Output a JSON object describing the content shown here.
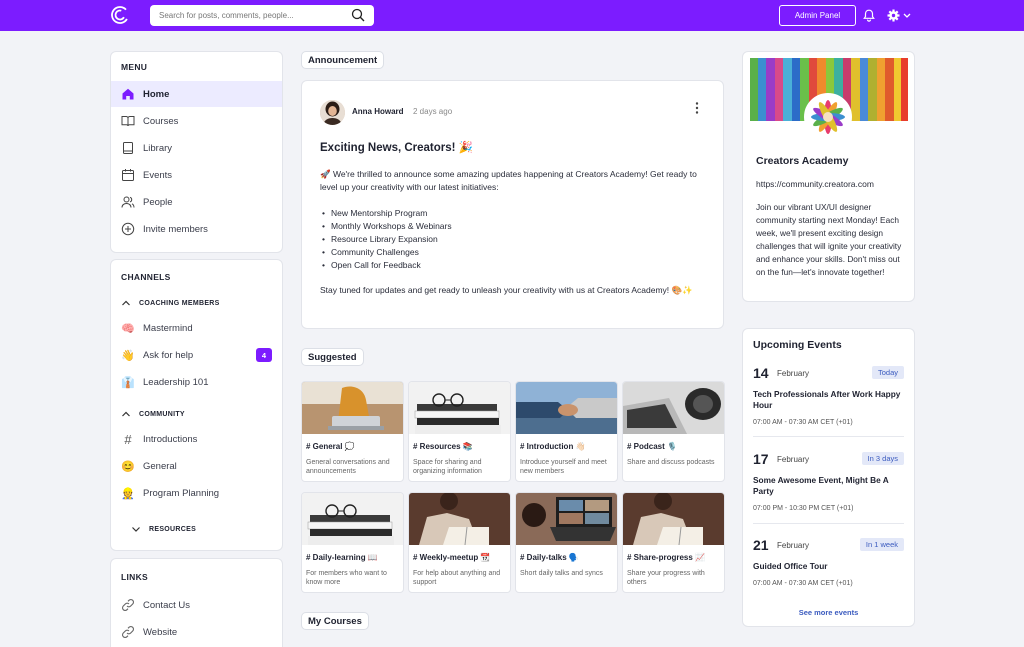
{
  "topbar": {
    "search_placeholder": "Search for posts, comments, people...",
    "admin_label": "Admin Panel"
  },
  "menu": {
    "title": "MENU",
    "items": [
      {
        "label": "Home",
        "icon": "home-icon",
        "active": true
      },
      {
        "label": "Courses",
        "icon": "book-open-icon"
      },
      {
        "label": "Library",
        "icon": "library-icon"
      },
      {
        "label": "Events",
        "icon": "calendar-icon"
      },
      {
        "label": "People",
        "icon": "people-icon"
      },
      {
        "label": "Invite members",
        "icon": "plus-circle-icon"
      }
    ]
  },
  "channels": {
    "title": "CHANNELS",
    "groups": [
      {
        "label": "COACHING MEMBERS",
        "items": [
          {
            "label": "Mastermind",
            "icon": "🧠"
          },
          {
            "label": "Ask for help",
            "icon": "👋",
            "badge": "4"
          },
          {
            "label": "Leadership 101",
            "icon": "👔"
          }
        ]
      },
      {
        "label": "COMMUNITY",
        "items": [
          {
            "label": "Introductions",
            "icon": "#"
          },
          {
            "label": "General",
            "icon": "😊"
          },
          {
            "label": "Program Planning",
            "icon": "👷"
          }
        ]
      },
      {
        "label": "RESOURCES",
        "items": []
      }
    ]
  },
  "links": {
    "title": "LINKS",
    "items": [
      {
        "label": "Contact Us"
      },
      {
        "label": "Website"
      }
    ]
  },
  "announcement": {
    "section_label": "Announcement",
    "author": "Anna Howard",
    "time": "2 days ago",
    "title": "Exciting News, Creators! 🎉",
    "intro": "🚀 We're thrilled to announce some amazing updates happening at Creators Academy! Get ready to level up your creativity with our latest initiatives:",
    "bullets": [
      "New Mentorship Program",
      "Monthly Workshops & Webinars",
      "Resource Library Expansion",
      "Community Challenges",
      "Open Call for Feedback"
    ],
    "outro": "Stay tuned for updates and get ready to unleash your creativity with us at Creators Academy! 🎨✨"
  },
  "suggested": {
    "section_label": "Suggested",
    "tiles": [
      {
        "name": "# General 💭",
        "desc": "General conversations and announcements",
        "thumb": "laptop-desk"
      },
      {
        "name": "# Resources 📚",
        "desc": "Space for sharing and organizing information",
        "thumb": "books-glasses"
      },
      {
        "name": "# Introduction 👋🏻",
        "desc": "Introduce yourself and meet new members",
        "thumb": "handshake"
      },
      {
        "name": "# Podcast 🎙️",
        "desc": "Share and discuss podcasts",
        "thumb": "headphones-laptop"
      },
      {
        "name": "# Daily-learning 📖",
        "desc": "For members who want to know more",
        "thumb": "books-glasses"
      },
      {
        "name": "# Weekly-meetup 📆",
        "desc": "For help about anything and support",
        "thumb": "reading-book"
      },
      {
        "name": "# Daily-talks 🗣️",
        "desc": "Short daily talks and syncs",
        "thumb": "video-call"
      },
      {
        "name": "# Share-progress 📈",
        "desc": "Share your progress with others",
        "thumb": "reading-book"
      }
    ]
  },
  "courses": {
    "section_label": "My Courses"
  },
  "community": {
    "name": "Creators Academy",
    "url": "https://community.creatora.com",
    "description": "Join our vibrant UX/UI designer community starting next Monday! Each week, we'll present exciting design challenges that will ignite your creativity and enhance your skills. Don't miss out on the fun—let's innovate together!"
  },
  "events": {
    "title": "Upcoming Events",
    "items": [
      {
        "day": "14",
        "month": "February",
        "tag": "Today",
        "name": "Tech Professionals After Work Happy Hour",
        "time": "07:00 AM - 07:30 AM CET (+01)"
      },
      {
        "day": "17",
        "month": "February",
        "tag": "In 3 days",
        "name": "Some Awesome Event, Might Be A Party",
        "time": "07:00 PM - 10:30 PM CET (+01)"
      },
      {
        "day": "21",
        "month": "February",
        "tag": "In 1 week",
        "name": "Guided Office Tour",
        "time": "07:00 AM - 07:30 AM CET (+01)"
      }
    ],
    "see_more": "See more events"
  },
  "colors": {
    "brand": "#7c1cff",
    "badge": "#7c1cff",
    "active_nav": "#ecebff",
    "tag_bg": "#e3e8f8",
    "link": "#3b5bbf"
  }
}
